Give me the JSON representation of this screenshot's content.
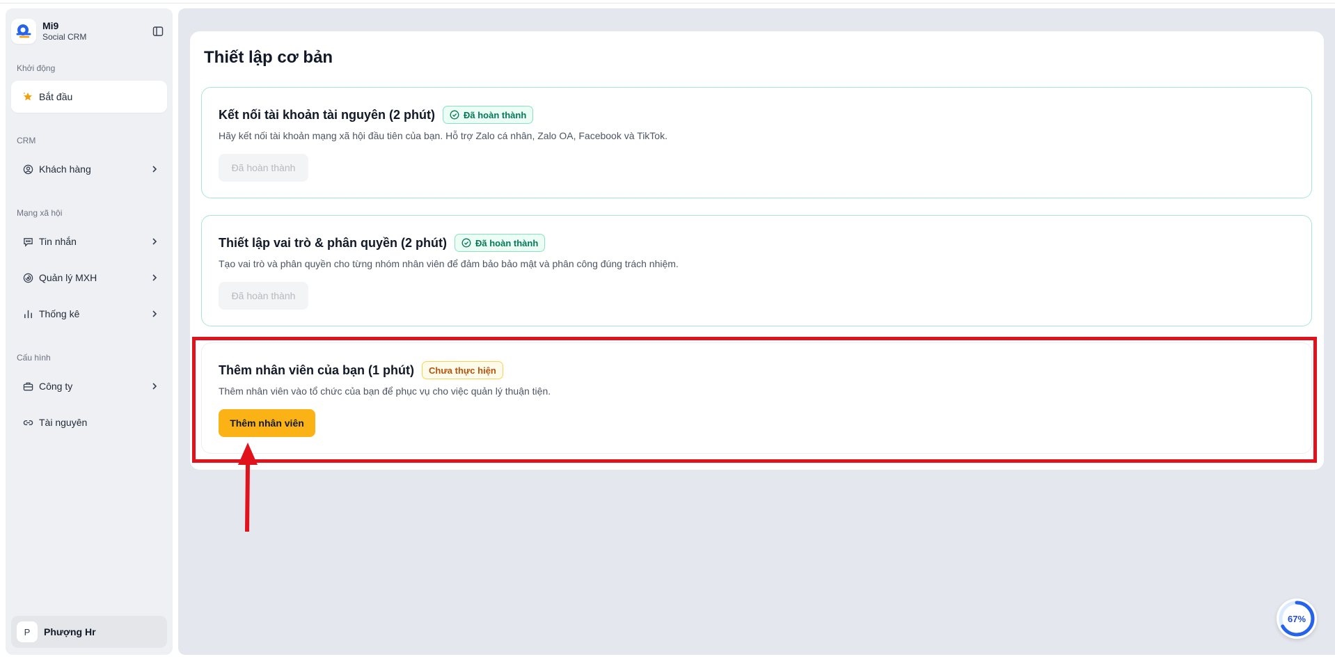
{
  "brand": {
    "name": "Mi9",
    "subtitle": "Social CRM"
  },
  "sidebar": {
    "sections": [
      {
        "label": "Khởi động"
      },
      {
        "label": "CRM"
      },
      {
        "label": "Mạng xã hội"
      },
      {
        "label": "Cấu hình"
      }
    ],
    "items": [
      {
        "label": "Bắt đầu",
        "icon": "star-icon",
        "active": true
      },
      {
        "label": "Khách hàng",
        "icon": "user-circle-icon"
      },
      {
        "label": "Tin nhắn",
        "icon": "message-icon"
      },
      {
        "label": "Quản lý MXH",
        "icon": "spiral-icon"
      },
      {
        "label": "Thống kê",
        "icon": "bar-chart-icon"
      },
      {
        "label": "Công ty",
        "icon": "briefcase-icon"
      },
      {
        "label": "Tài nguyên",
        "icon": "link-icon"
      }
    ]
  },
  "user": {
    "initial": "P",
    "name": "Phượng Hr"
  },
  "main": {
    "title": "Thiết lập cơ bản",
    "tasks": [
      {
        "title": "Kết nối tài khoản tài nguyên (2 phút)",
        "status": "Đã hoàn thành",
        "description": "Hãy kết nối tài khoản mạng xã hội đầu tiên của bạn. Hỗ trợ Zalo cá nhân, Zalo OA, Facebook và TikTok.",
        "button": "Đã hoàn thành"
      },
      {
        "title": "Thiết lập vai trò & phân quyền (2 phút)",
        "status": "Đã hoàn thành",
        "description": "Tạo vai trò và phân quyền cho từng nhóm nhân viên để đảm bảo bảo mật và phân công đúng trách nhiệm.",
        "button": "Đã hoàn thành"
      },
      {
        "title": "Thêm nhân viên của bạn (1 phút)",
        "status": "Chưa thực hiện",
        "description": "Thêm nhân viên vào tổ chức của bạn để phục vụ cho việc quản lý thuận tiện.",
        "button": "Thêm nhân viên"
      }
    ]
  },
  "progress": {
    "label": "67%",
    "value": 0.67
  },
  "colors": {
    "accent": "#fbb215",
    "success": "#047857",
    "warning": "#b45309",
    "annotation": "#e0121b",
    "progress": "#1d4ed8"
  }
}
